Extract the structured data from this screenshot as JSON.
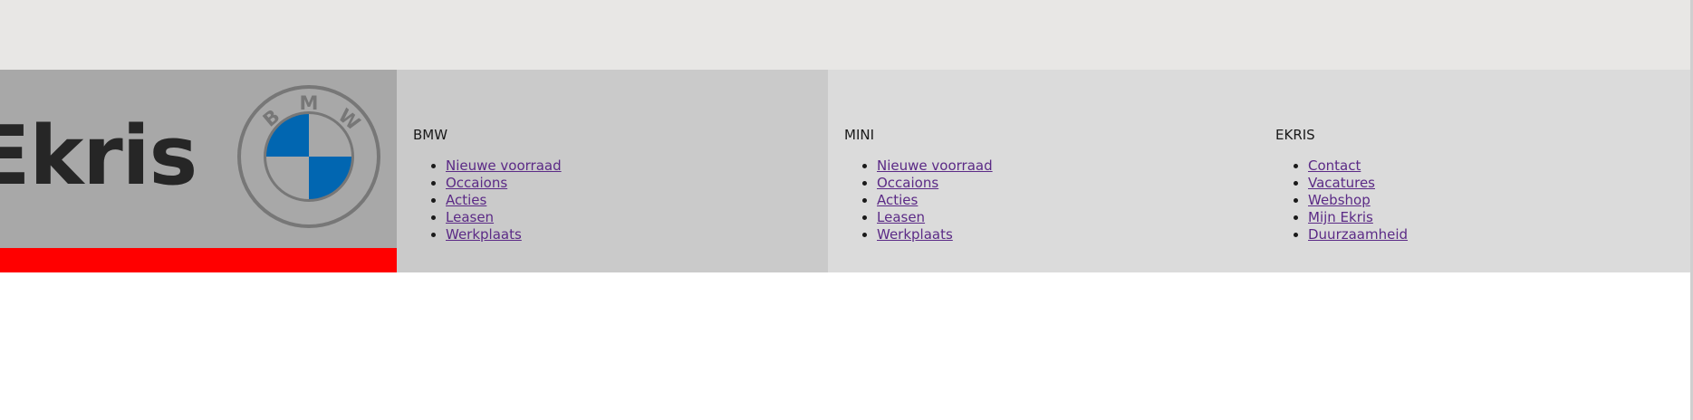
{
  "brand": {
    "name": "Ekris",
    "logo_letters": [
      "B",
      "M",
      "W"
    ],
    "logo_icon": "bmw-roundel-icon"
  },
  "colors": {
    "top_band": "#e8e7e5",
    "brand_panel": "#a8a8a8",
    "accent_red": "#ff0000",
    "bmw_blue": "#0166b1",
    "col_bmw_bg": "#cacaca",
    "col_other_bg": "#dbdbdb",
    "link": "#5b2a86"
  },
  "footer": {
    "columns": [
      {
        "title": "BMW",
        "links": [
          "Nieuwe voorraad",
          "Occaions",
          "Acties",
          "Leasen",
          "Werkplaats"
        ]
      },
      {
        "title": "MINI",
        "links": [
          "Nieuwe voorraad",
          "Occaions",
          "Acties",
          "Leasen",
          "Werkplaats"
        ]
      },
      {
        "title": "EKRIS",
        "links": [
          "Contact",
          "Vacatures",
          "Webshop",
          "Mijn Ekris",
          "Duurzaamheid"
        ]
      }
    ]
  }
}
